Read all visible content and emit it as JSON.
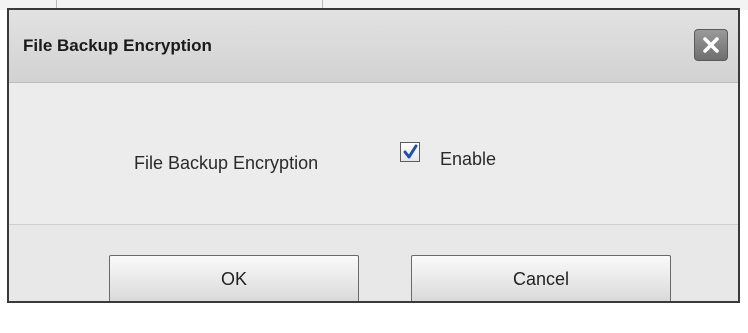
{
  "dialog": {
    "title": "File Backup Encryption",
    "close_icon": "close-icon"
  },
  "content": {
    "field_label": "File Backup Encryption",
    "checkbox": {
      "checked": true,
      "label": "Enable"
    }
  },
  "footer": {
    "ok_label": "OK",
    "cancel_label": "Cancel"
  },
  "colors": {
    "title_bar": "#d8d8d8",
    "content_bg": "#ececec",
    "checkmark": "#1f4fb5",
    "close_button": "#7c7c7c"
  }
}
